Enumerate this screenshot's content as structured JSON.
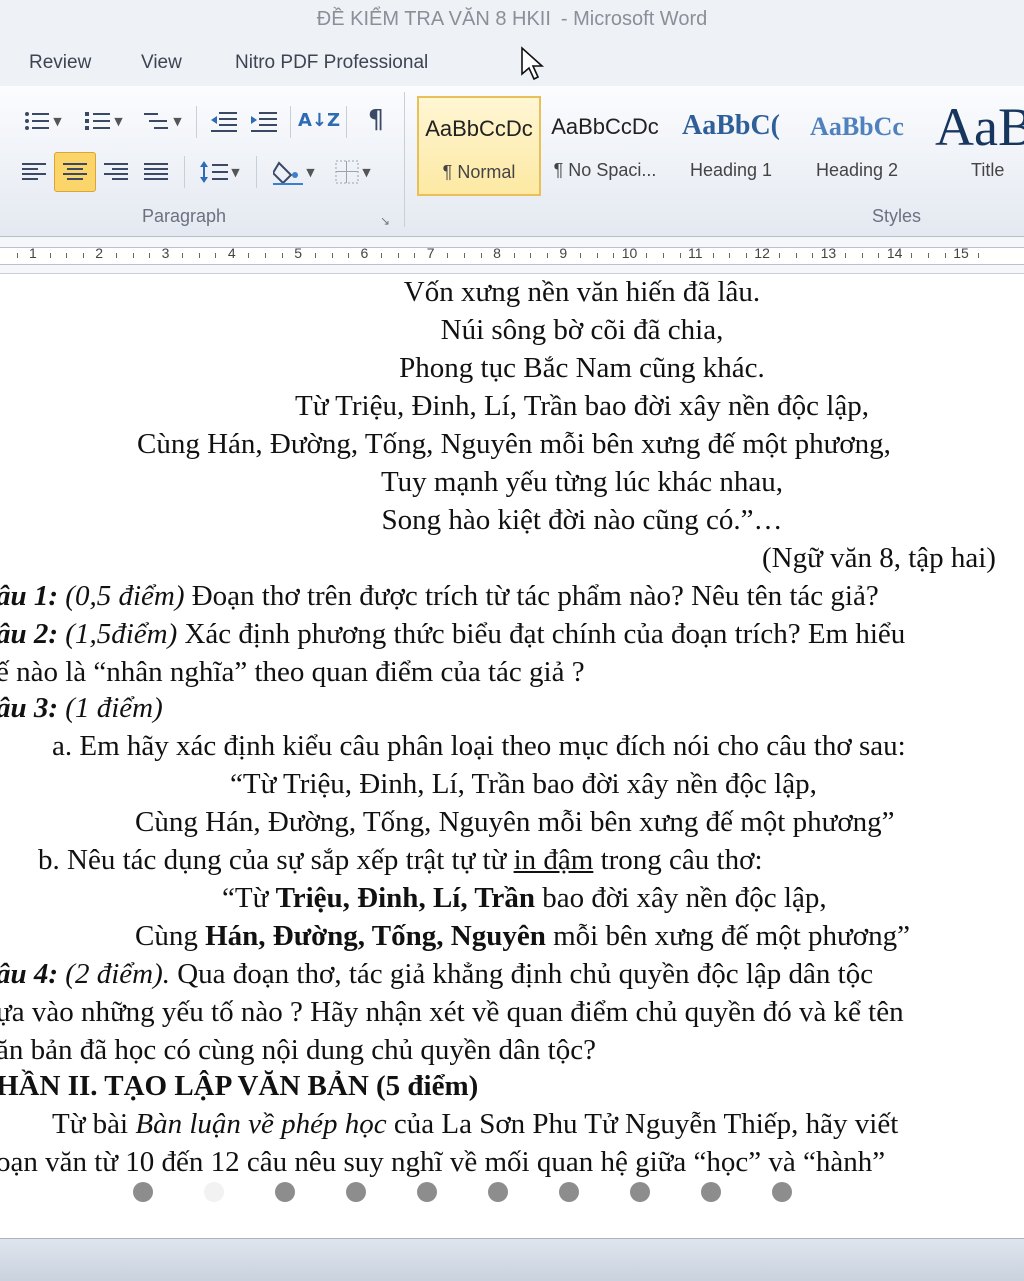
{
  "window": {
    "title": "ĐỀ KIỂM TRA VĂN 8 HKII",
    "app_name": "-  Microsoft Word"
  },
  "tabs": [
    "Review",
    "View",
    "Nitro PDF Professional"
  ],
  "ribbon": {
    "paragraph_group_label": "Paragraph",
    "styles_group_label": "Styles",
    "styles": [
      {
        "sample": "AaBbCcDc",
        "name": "¶ Normal"
      },
      {
        "sample": "AaBbCcDc",
        "name": "¶ No Spaci..."
      },
      {
        "sample": "AaBbC(",
        "name": "Heading 1"
      },
      {
        "sample": "AaBbCc",
        "name": "Heading 2"
      },
      {
        "sample": "AaB",
        "name": "Title"
      }
    ],
    "icons": {
      "pilcrow": "¶",
      "sort": "A↓Z"
    }
  },
  "ruler": {
    "numbers": [
      "1",
      "2",
      "3",
      "4",
      "5",
      "6",
      "7",
      "8",
      "9",
      "10",
      "11",
      "12",
      "13",
      "14",
      "15"
    ]
  },
  "document": {
    "poem": [
      "Vốn xưng nền văn hiến đã lâu.",
      "Núi sông bờ cõi đã chia,",
      "Phong tục Bắc Nam cũng khác.",
      "Từ Triệu, Đinh, Lí, Trần bao đời xây nền độc lập,",
      "Cùng Hán, Đường, Tống, Nguyên mỗi bên xưng đế một phương,",
      "Tuy mạnh yếu từng lúc khác nhau,",
      "Song hào kiệt đời nào cũng có.”…"
    ],
    "source": "(Ngữ văn 8, tập hai)",
    "q1_label": "âu 1:",
    "q1_points": " (0,5 điểm) ",
    "q1_text": " Đoạn thơ trên được trích từ tác phẩm nào? Nêu tên tác giả?",
    "q2_label": "âu 2:",
    "q2_points": " (1,5điểm)",
    "q2_text": " Xác định phương thức biểu đạt chính của đoạn trích? Em hiểu",
    "q2_text2": "ế nào là “nhân nghĩa” theo quan điểm của tác giả ?",
    "q3_label": "âu 3:",
    "q3_points": " (1 điểm)",
    "q3a": "a. Em hãy xác định kiểu câu phân loại theo mục đích nói cho câu thơ sau:",
    "q3a_quote1": "“Từ Triệu, Đinh, Lí, Trần bao đời xây nền độc lập,",
    "q3a_quote2": "Cùng Hán, Đường, Tống, Nguyên mỗi bên xưng đế một phương”",
    "q3b_pre": "b. Nêu tác dụng của sự sắp xếp trật tự từ ",
    "q3b_underline": "in đậm",
    "q3b_post": " trong câu thơ:",
    "q3b_q1_pre": "“Từ ",
    "q3b_q1_bold": "Triệu, Đinh, Lí, Trần",
    "q3b_q1_post": " bao đời xây nền độc lập,",
    "q3b_q2_pre": "Cùng ",
    "q3b_q2_bold": "Hán, Đường, Tống, Nguyên",
    "q3b_q2_post": " mỗi bên xưng đế một phương”",
    "q4_label": "âu 4:",
    "q4_points": " (2 điểm).",
    "q4_text": "  Qua đoạn thơ, tác giả khẳng định chủ quyền độc lập dân tộc",
    "q4_text2": "ựa vào những yếu tố nào ? Hãy nhận xét về quan điểm chủ quyền đó và  kể tên",
    "q4_text3": "ăn bản đã học có cùng nội dung chủ quyền dân tộc?",
    "part2_heading": "HẦN II. TẠO LẬP VĂN BẢN (5 điểm)",
    "part2_pre": "Từ bài ",
    "part2_italic": "Bàn luận về phép học",
    "part2_post": " của La Sơn Phu Tử Nguyễn Thiếp, hãy viết",
    "part2_line2": "oạn  văn từ 10 đến 12 câu  nêu suy nghĩ về mối quan hệ giữa “học” và “hành”"
  },
  "colors": {
    "accent": "#fbd46a",
    "heading": "#2f5f98",
    "ribbon_bg": "#eef1f6"
  }
}
